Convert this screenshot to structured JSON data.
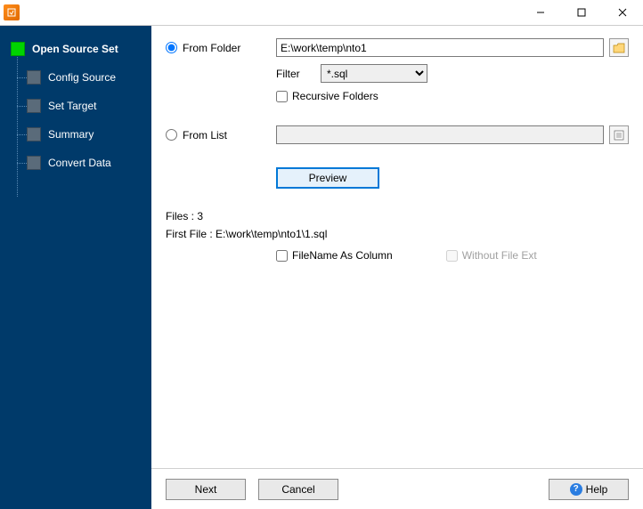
{
  "sidebar": {
    "root": "Open Source Set",
    "items": [
      {
        "label": "Config Source"
      },
      {
        "label": "Set Target"
      },
      {
        "label": "Summary"
      },
      {
        "label": "Convert Data"
      }
    ]
  },
  "form": {
    "from_folder_label": "From Folder",
    "folder_path": "E:\\work\\temp\\nto1",
    "filter_label": "Filter",
    "filter_value": "*.sql",
    "recursive_label": "Recursive Folders",
    "from_list_label": "From List",
    "list_path": "",
    "preview_label": "Preview",
    "files_count_label": "Files : 3",
    "first_file_label": "First File : E:\\work\\temp\\nto1\\1.sql",
    "filename_as_column_label": "FileName As Column",
    "without_ext_label": "Without File Ext"
  },
  "buttons": {
    "next": "Next",
    "cancel": "Cancel",
    "help": "Help"
  }
}
